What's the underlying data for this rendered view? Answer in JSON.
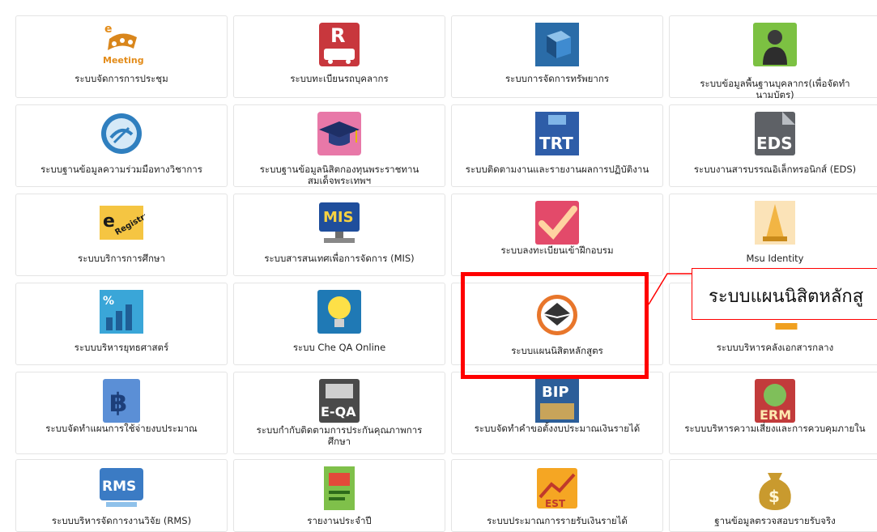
{
  "tiles": [
    {
      "label": "ระบบจัดการการประชุม",
      "icon": "meeting-icon",
      "sub": "Meeting"
    },
    {
      "label": "ระบบทะเบียนรถบุคลากร",
      "icon": "car-registration-icon",
      "sub": "R"
    },
    {
      "label": "ระบบการจัดการทรัพยากร",
      "icon": "resource-cube-icon"
    },
    {
      "label": "ระบบข้อมูลพื้นฐานบุคลากร(เพื่อจัดทำนามบัตร)",
      "icon": "personnel-icon"
    },
    {
      "label": "ระบบฐานข้อมูลความร่วมมือทางวิชาการ",
      "icon": "cooperation-icon"
    },
    {
      "label": "ระบบฐานข้อมูลนิสิตกองทุนพระราชทานสมเด็จพระเทพฯ",
      "icon": "graduation-cap-icon"
    },
    {
      "label": "ระบบติดตามงานและรายงานผลการปฏิบัติงาน",
      "icon": "trt-icon",
      "sub": "TRT"
    },
    {
      "label": "ระบบงานสารบรรณอิเล็กทรอนิกส์ (EDS)",
      "icon": "eds-icon",
      "sub": "EDS"
    },
    {
      "label": "ระบบบริการการศึกษา",
      "icon": "registrar-icon",
      "sub": "Registrar"
    },
    {
      "label": "ระบบสารสนเทศเพื่อการจัดการ (MIS)",
      "icon": "mis-icon",
      "sub": "MIS"
    },
    {
      "label": "ระบบลงทะเบียนเข้าฝึกอบรม",
      "icon": "checkmark-icon"
    },
    {
      "label": "Msu Identity",
      "icon": "temple-icon"
    },
    {
      "label": "ระบบบริหารยุทธศาสตร์",
      "icon": "strategy-chart-icon",
      "sub": "%"
    },
    {
      "label": "ระบบ Che QA Online",
      "icon": "lightbulb-icon"
    },
    {
      "label": "ระบบแผนนิสิตหลักสูตร",
      "icon": "envelope-icon"
    },
    {
      "label": "ระบบบริหารคลังเอกสารกลาง",
      "icon": "document-store-icon"
    },
    {
      "label": "ระบบจัดทำแผนการใช้จ่ายงบประมาณ",
      "icon": "baht-icon",
      "sub": "฿"
    },
    {
      "label": "ระบบกำกับติดตามการประกันคุณภาพการศึกษา",
      "icon": "eqa-icon",
      "sub": "E-QA"
    },
    {
      "label": "ระบบจัดทำคำขอตั้งงบประมาณเงินรายได้",
      "icon": "bip-icon",
      "sub": "BIP"
    },
    {
      "label": "ระบบบริหารความเสี่ยงและการควบคุมภายใน",
      "icon": "erm-icon",
      "sub": "ERM"
    },
    {
      "label": "ระบบบริหารจัดการงานวิจัย (RMS)",
      "icon": "rms-icon",
      "sub": "RMS"
    },
    {
      "label": "รายงานประจำปี",
      "icon": "annual-report-icon"
    },
    {
      "label": "ระบบประมาณการรายรับเงินรายได้",
      "icon": "est-icon",
      "sub": "EST"
    },
    {
      "label": "ฐานข้อมูลตรวจสอบรายรับจริง",
      "icon": "money-bag-icon",
      "sub": "$"
    }
  ],
  "callout": {
    "text": "ระบบแผนนิสิตหลักสู"
  },
  "colors": {
    "highlight": "#ff0000"
  }
}
